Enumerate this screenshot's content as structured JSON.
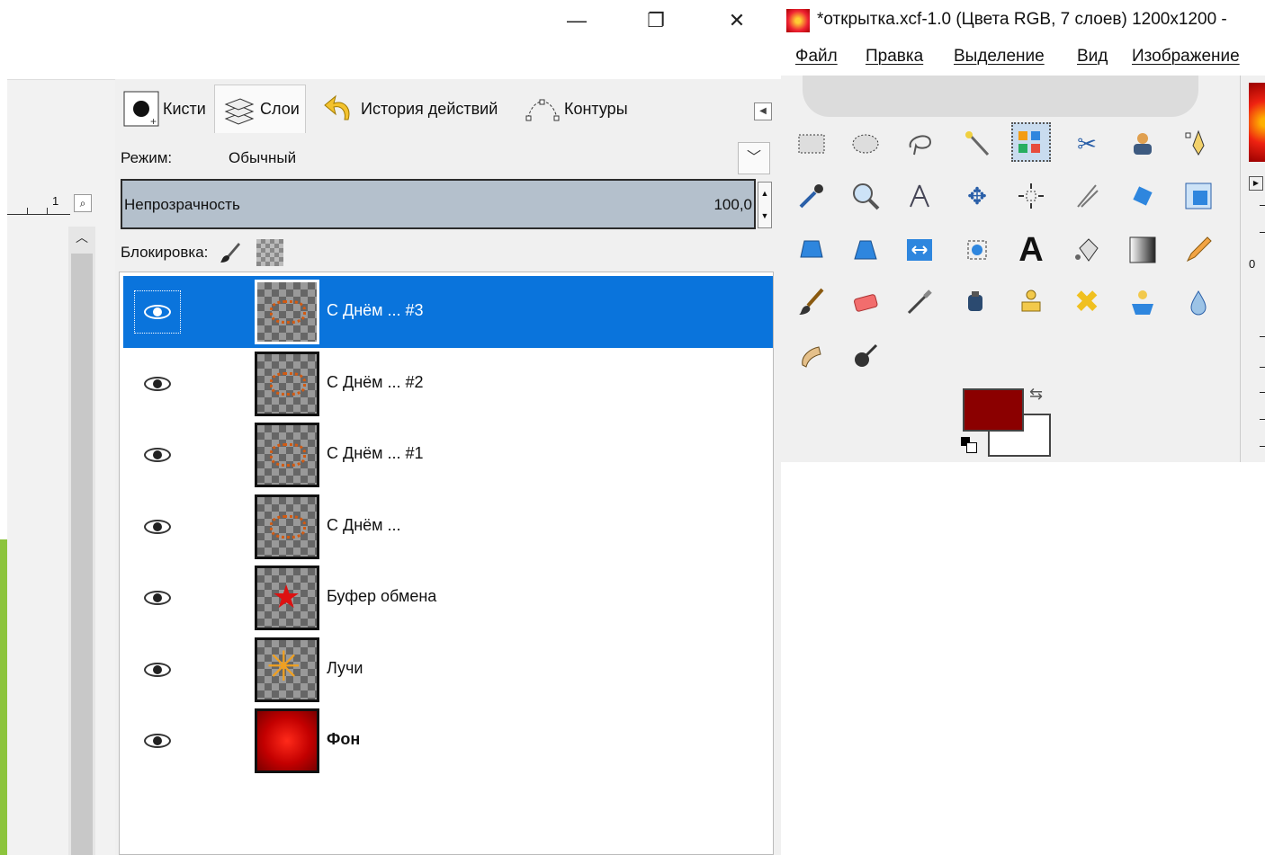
{
  "window_controls": {
    "minimize": "—",
    "restore": "❐",
    "close": "✕"
  },
  "left": {
    "ruler_number": "1"
  },
  "dock": {
    "tabs": [
      {
        "label": "Кисти",
        "icon": "brush-icon"
      },
      {
        "label": "Слои",
        "icon": "layers-icon"
      },
      {
        "label": "История действий",
        "icon": "undo-history-icon"
      },
      {
        "label": "Контуры",
        "icon": "paths-icon"
      }
    ],
    "active_tab": "Слои",
    "mode_label": "Режим:",
    "mode_value": "Обычный",
    "opacity_label": "Непрозрачность",
    "opacity_value": "100,0",
    "lock_label": "Блокировка:"
  },
  "layers": [
    {
      "name": "С Днём ... #3",
      "visible": true,
      "selected": true,
      "thumb": "text"
    },
    {
      "name": "С Днём ... #2",
      "visible": true,
      "selected": false,
      "thumb": "text"
    },
    {
      "name": "С Днём ... #1",
      "visible": true,
      "selected": false,
      "thumb": "text"
    },
    {
      "name": "С Днём ...",
      "visible": true,
      "selected": false,
      "thumb": "text"
    },
    {
      "name": "Буфер обмена",
      "visible": true,
      "selected": false,
      "thumb": "star"
    },
    {
      "name": "Лучи",
      "visible": true,
      "selected": false,
      "thumb": "rays"
    },
    {
      "name": "Фон",
      "visible": true,
      "selected": false,
      "thumb": "fon",
      "bold": true
    }
  ],
  "gimp": {
    "title": "*открытка.xcf-1.0 (Цвета RGB, 7 слоев) 1200x1200 -",
    "menu": [
      "Файл",
      "Правка",
      "Выделение",
      "Вид",
      "Изображение"
    ],
    "fg_color": "#8b0000",
    "bg_color": "#ffffff",
    "edge_zero": "0"
  },
  "colors": {
    "selection": "#0a74dc",
    "accent_green": "#8cc43c"
  }
}
